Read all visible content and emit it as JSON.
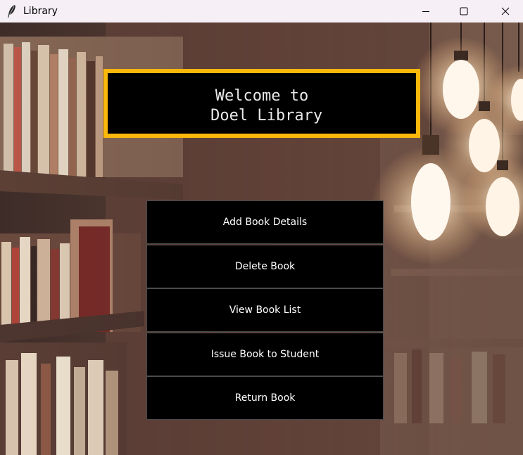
{
  "window": {
    "title": "Library",
    "icons": {
      "app": "feather-icon",
      "minimize": "minimize-icon",
      "maximize": "maximize-icon",
      "close": "close-icon"
    }
  },
  "heading": {
    "line1": "Welcome to",
    "line2": "Doel Library",
    "border_color": "#f9b80a",
    "background": "#000000",
    "text_color": "#e8e8e8"
  },
  "menu": {
    "buttons": [
      {
        "label": "Add Book Details"
      },
      {
        "label": "Delete Book"
      },
      {
        "label": "View Book List"
      },
      {
        "label": "Issue Book to Student"
      },
      {
        "label": "Return Book"
      }
    ],
    "button_background": "#000000",
    "button_text_color": "#ffffff"
  },
  "background_image": "library-bookshelves-with-hanging-lightbulbs"
}
